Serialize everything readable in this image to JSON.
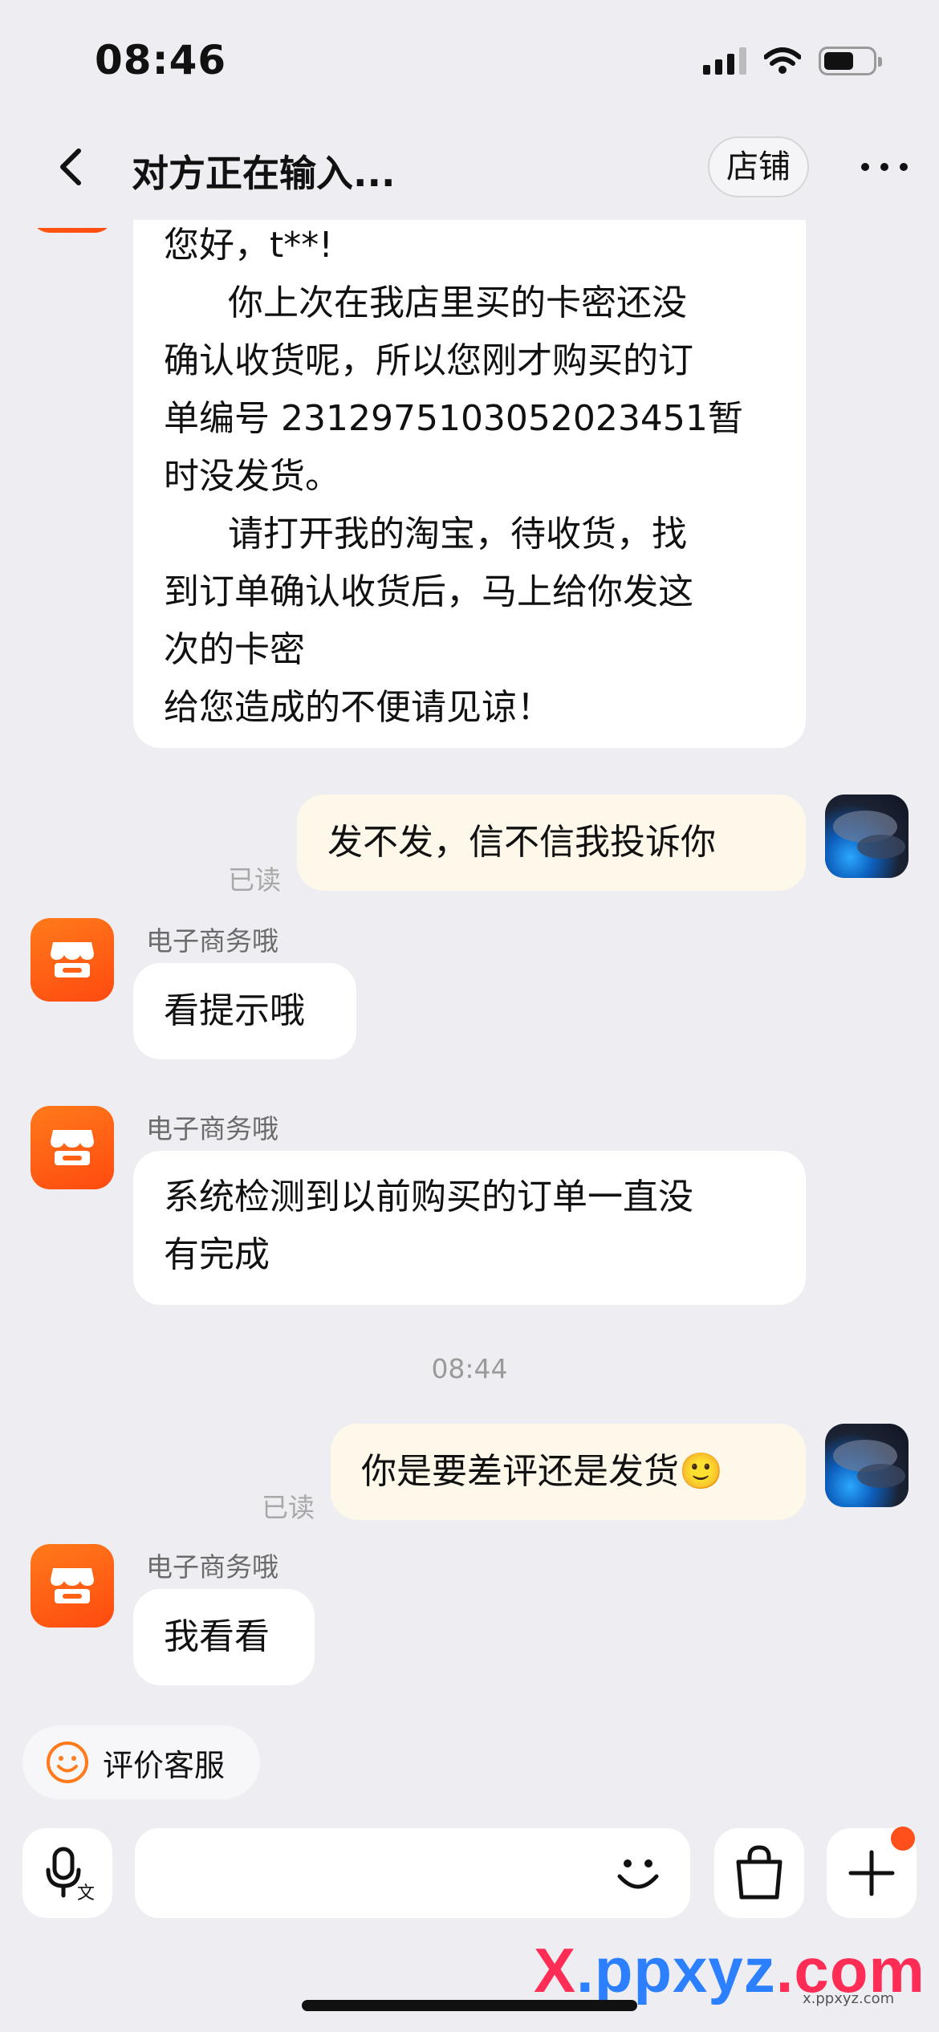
{
  "status_bar": {
    "time": "08:46"
  },
  "nav": {
    "title": "对方正在输入...",
    "shop_label": "店铺"
  },
  "messages": {
    "m1": {
      "lines": [
        "您好，t**!",
        "你上次在我店里买的卡密还没",
        "确认收货呢，所以您刚才购买的订",
        "单编号 2312975103052023451暂",
        "时没发货。",
        "请打开我的淘宝，待收货，找",
        "到订单确认收货后，马上给你发这",
        "次的卡密",
        "给您造成的不便请见谅！"
      ]
    },
    "m2": {
      "text": "发不发，信不信我投诉你",
      "read": "已读"
    },
    "m3": {
      "sender": "电子商务哦",
      "text": "看提示哦"
    },
    "m4": {
      "sender": "电子商务哦",
      "lines": [
        "系统检测到以前购买的订单一直没",
        "有完成"
      ]
    },
    "time_divider": "08:44",
    "m5": {
      "text": "你是要差评还是发货🙂",
      "read": "已读"
    },
    "m6": {
      "sender": "电子商务哦",
      "text": "我看看"
    }
  },
  "rate_chip": {
    "label": "评价客服"
  },
  "input_bar": {
    "placeholder": ""
  },
  "watermark": {
    "x": "X",
    "ppxyz": ".ppxyz",
    "com": ".com",
    "small": "x.ppxyz.com"
  },
  "colors": {
    "accent": "#ff5a14",
    "my_bubble": "#fdf8ea",
    "background": "#eeeef2"
  }
}
